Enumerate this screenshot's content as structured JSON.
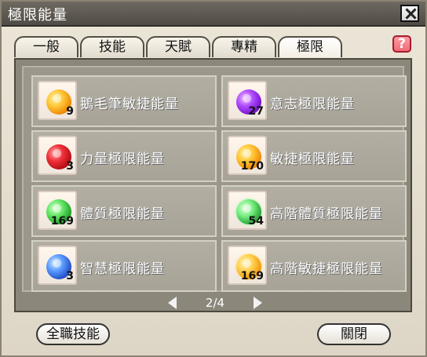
{
  "window": {
    "title": "極限能量"
  },
  "tabs": [
    {
      "label": "一般"
    },
    {
      "label": "技能"
    },
    {
      "label": "天賦"
    },
    {
      "label": "專精"
    },
    {
      "label": "極限",
      "active": true
    }
  ],
  "items": [
    {
      "name": "鵝毛筆敏捷能量",
      "qty": "9",
      "orb_color": "#f2a61a",
      "icon": "orange-orb-icon"
    },
    {
      "name": "意志極限能量",
      "qty": "27",
      "orb_color": "#8a2bd8",
      "icon": "purple-orb-icon"
    },
    {
      "name": "力量極限能量",
      "qty": "3",
      "orb_color": "#c9171f",
      "icon": "red-orb-icon"
    },
    {
      "name": "敏捷極限能量",
      "qty": "170",
      "orb_color": "#f09a17",
      "icon": "orange-orb-icon"
    },
    {
      "name": "體質極限能量",
      "qty": "169",
      "orb_color": "#35b63c",
      "icon": "green-orb-icon"
    },
    {
      "name": "高階體質極限能量",
      "qty": "54",
      "orb_color": "#47c85a",
      "icon": "green-atom-icon"
    },
    {
      "name": "智慧極限能量",
      "qty": "3",
      "orb_color": "#2c58c8",
      "icon": "blue-orb-icon"
    },
    {
      "name": "高階敏捷極限能量",
      "qty": "169",
      "orb_color": "#f2a61a",
      "icon": "orange-atom-icon"
    }
  ],
  "pagination": {
    "current": "2/4"
  },
  "buttons": {
    "all_skills": "全職技能",
    "close": "關閉"
  },
  "icons": {
    "close": "close-icon",
    "help": "question-icon",
    "prev": "left-arrow-icon",
    "next": "right-arrow-icon"
  }
}
